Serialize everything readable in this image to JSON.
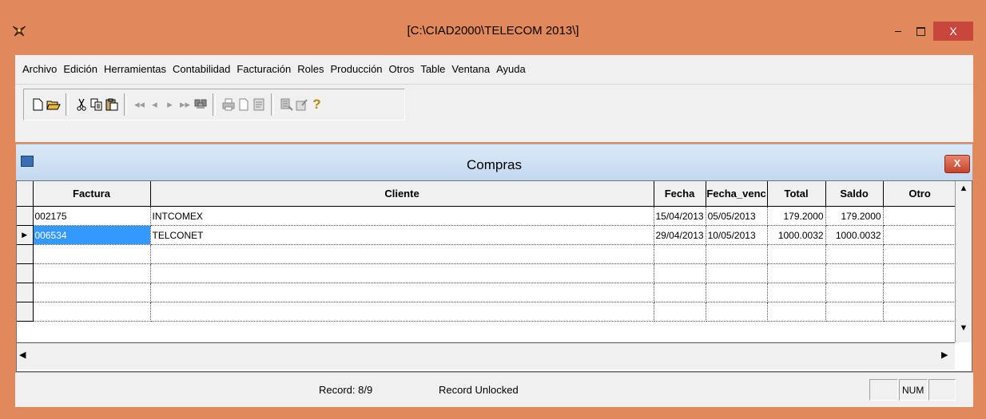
{
  "window": {
    "title": "[C:\\CIAD2000\\TELECOM 2013\\]",
    "app_icon": "app-logo-icon",
    "minimize_label": "–",
    "close_label": "X"
  },
  "menu": {
    "items": [
      {
        "label": "Archivo"
      },
      {
        "label": "Edición"
      },
      {
        "label": "Herramientas"
      },
      {
        "label": "Contabilidad"
      },
      {
        "label": "Facturación"
      },
      {
        "label": "Roles"
      },
      {
        "label": "Producción"
      },
      {
        "label": "Otros"
      },
      {
        "label": "Table"
      },
      {
        "label": "Ventana"
      },
      {
        "label": "Ayuda"
      }
    ]
  },
  "toolbar": {
    "icons": [
      "new-icon",
      "open-icon",
      "cut-icon",
      "copy-icon",
      "paste-icon",
      "first-record-icon",
      "prev-record-icon",
      "next-record-icon",
      "last-record-icon",
      "find-icon",
      "print-icon",
      "page-icon",
      "report-icon",
      "filter-icon",
      "edit-icon",
      "help-icon"
    ]
  },
  "compras": {
    "title": "Compras",
    "close_label": "X",
    "columns": [
      "Factura",
      "Cliente",
      "Fecha",
      "Fecha_venc",
      "Total",
      "Saldo",
      "Otro"
    ],
    "rows": [
      {
        "factura": "002175",
        "cliente": "INTCOMEX",
        "fecha": "15/04/2013",
        "fecha_venc": "05/05/2013",
        "total": "179.2000",
        "saldo": "179.2000",
        "otro": ""
      },
      {
        "factura": "006534",
        "cliente": "TELCONET",
        "fecha": "29/04/2013",
        "fecha_venc": "10/05/2013",
        "total": "1000.0032",
        "saldo": "1000.0032",
        "otro": ""
      }
    ],
    "current_row_marker": "▶",
    "selected_color": "#3399ff"
  },
  "status": {
    "record": "Record: 8/9",
    "lock": "Record Unlocked",
    "num": "NUM"
  },
  "colors": {
    "frame": "#e2895c",
    "close_button": "#c9463d",
    "child_title_bar": "#c2d8f0"
  }
}
